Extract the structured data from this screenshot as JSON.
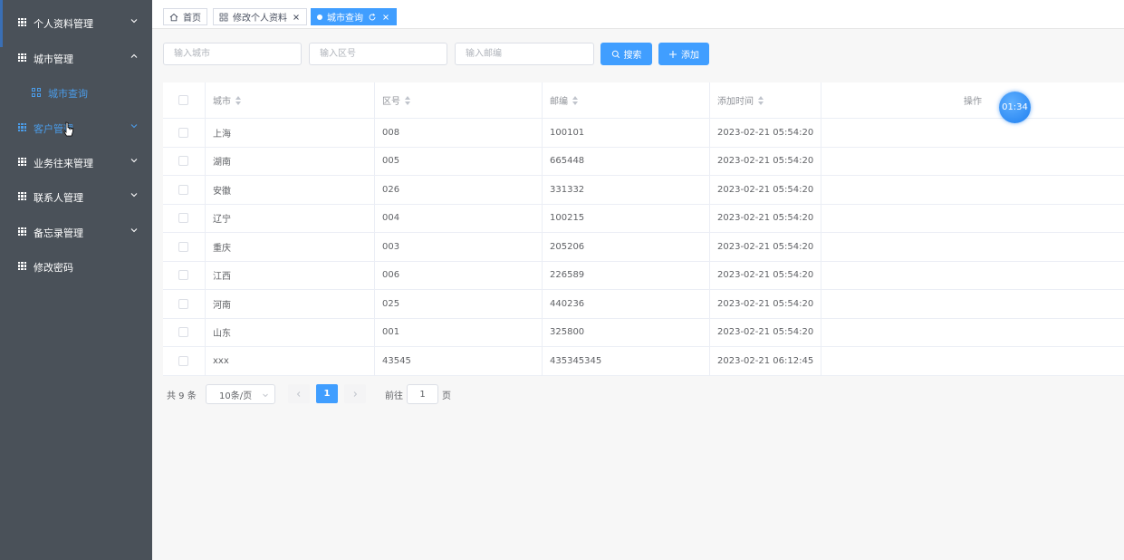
{
  "sidebar": {
    "items": [
      {
        "label": "个人资料管理"
      },
      {
        "label": "城市管理"
      },
      {
        "label": "城市查询"
      },
      {
        "label": "客户管理"
      },
      {
        "label": "业务往来管理"
      },
      {
        "label": "联系人管理"
      },
      {
        "label": "备忘录管理"
      },
      {
        "label": "修改密码"
      }
    ]
  },
  "tabs": [
    {
      "label": "首页"
    },
    {
      "label": "修改个人资料"
    },
    {
      "label": "城市查询"
    }
  ],
  "search": {
    "city_placeholder": "输入城市",
    "district_placeholder": "输入区号",
    "zip_placeholder": "输入邮编",
    "search_label": "搜索",
    "add_label": "添加"
  },
  "table": {
    "columns": [
      "城市",
      "区号",
      "邮编",
      "添加时间",
      "操作"
    ],
    "rows": [
      {
        "city": "上海",
        "code": "008",
        "zip": "100101",
        "time": "2023-02-21 05:54:20"
      },
      {
        "city": "湖南",
        "code": "005",
        "zip": "665448",
        "time": "2023-02-21 05:54:20"
      },
      {
        "city": "安徽",
        "code": "026",
        "zip": "331332",
        "time": "2023-02-21 05:54:20"
      },
      {
        "city": "辽宁",
        "code": "004",
        "zip": "100215",
        "time": "2023-02-21 05:54:20"
      },
      {
        "city": "重庆",
        "code": "003",
        "zip": "205206",
        "time": "2023-02-21 05:54:20"
      },
      {
        "city": "江西",
        "code": "006",
        "zip": "226589",
        "time": "2023-02-21 05:54:20"
      },
      {
        "city": "河南",
        "code": "025",
        "zip": "440236",
        "time": "2023-02-21 05:54:20"
      },
      {
        "city": "山东",
        "code": "001",
        "zip": "325800",
        "time": "2023-02-21 05:54:20"
      },
      {
        "city": "xxx",
        "code": "43545",
        "zip": "435345345",
        "time": "2023-02-21 06:12:45"
      }
    ]
  },
  "timer": "01:34",
  "pagination": {
    "total": "共 9 条",
    "page_size": "10条/页",
    "current": "1",
    "goto_label": "前往",
    "goto_value": "1",
    "page_suffix": "页"
  },
  "colors": {
    "sidebar_bg": "#4a5159",
    "accent": "#409eff",
    "active_menu": "#4b9ce8"
  }
}
